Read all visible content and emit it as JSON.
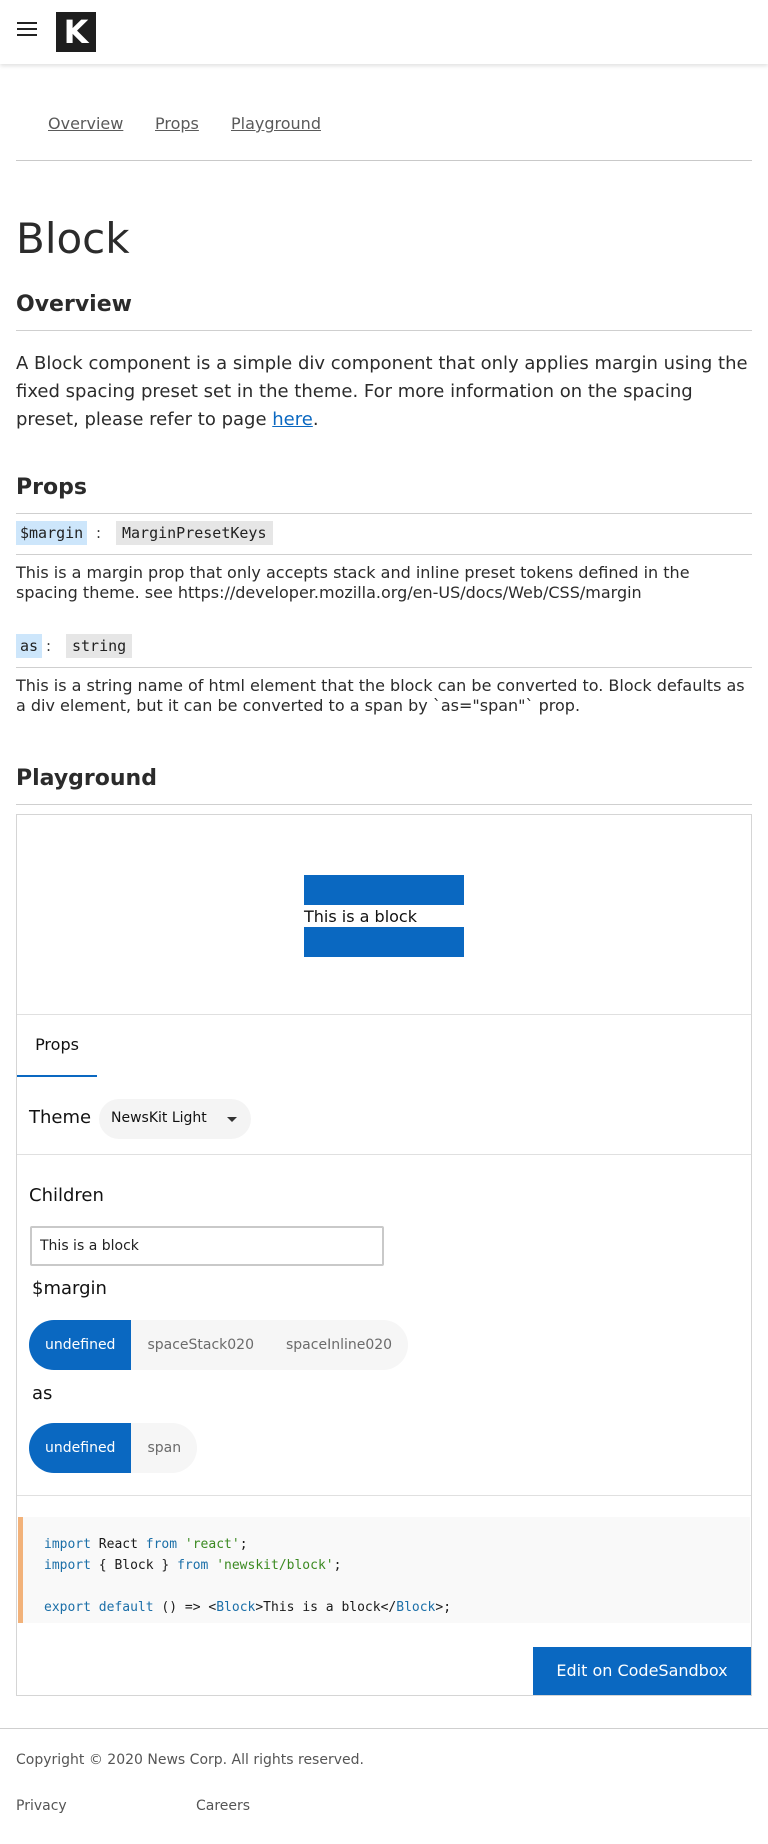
{
  "header": {
    "logo_letter": "K",
    "menu_icon": "hamburger-icon"
  },
  "tabs": [
    "Overview",
    "Props",
    "Playground"
  ],
  "page_title": "Block",
  "overview": {
    "title": "Overview",
    "text_before_link": "A Block component is a simple div component that only applies margin using the fixed spacing preset set in the theme. For more information on the spacing preset, please refer to page ",
    "link": "here",
    "text_after_link": "."
  },
  "props": {
    "title": "Props",
    "items": [
      {
        "name": "$margin",
        "type": "MarginPresetKeys",
        "description": "This is a margin prop that only accepts stack and inline preset tokens defined in the spacing theme. see https://developer.mozilla.org/en-US/docs/Web/CSS/margin"
      },
      {
        "name": "as",
        "type": "string",
        "description": "This is a string name of html element that the block can be converted to. Block defaults as a div element, but it can be converted to a span by `as=\"span\"` prop."
      }
    ]
  },
  "playground": {
    "title": "Playground",
    "preview_text": "This is a block",
    "props_tab": "Props",
    "theme_label": "Theme",
    "theme_value": "NewsKit Light",
    "children_label": "Children",
    "children_value": "This is a block",
    "margin_label": "$margin",
    "margin_options": [
      "undefined",
      "spaceStack020",
      "spaceInline020"
    ],
    "as_label": "as",
    "as_options": [
      "undefined",
      "span"
    ],
    "code": {
      "line1": {
        "k1": "import",
        "t1": " React ",
        "k2": "from",
        "t2": " ",
        "s": "'react'",
        "t3": ";"
      },
      "line2": {
        "k1": "import",
        "t1": " { Block } ",
        "k2": "from",
        "t2": " ",
        "s": "'newskit/block'",
        "t3": ";"
      },
      "line3": {
        "k1": "export",
        "t1": " ",
        "k2": "default",
        "t2": " () => <",
        "c1": "Block",
        "t3": ">This is a block</",
        "c2": "Block",
        "t4": ">;"
      }
    },
    "edit_button": "Edit on CodeSandbox"
  },
  "footer": {
    "copyright": "Copyright © 2020 News Corp. All rights reserved.",
    "links": [
      "Privacy",
      "Careers"
    ]
  },
  "colors": {
    "accent": "#0a68c1",
    "code_border": "#f2b27a"
  }
}
